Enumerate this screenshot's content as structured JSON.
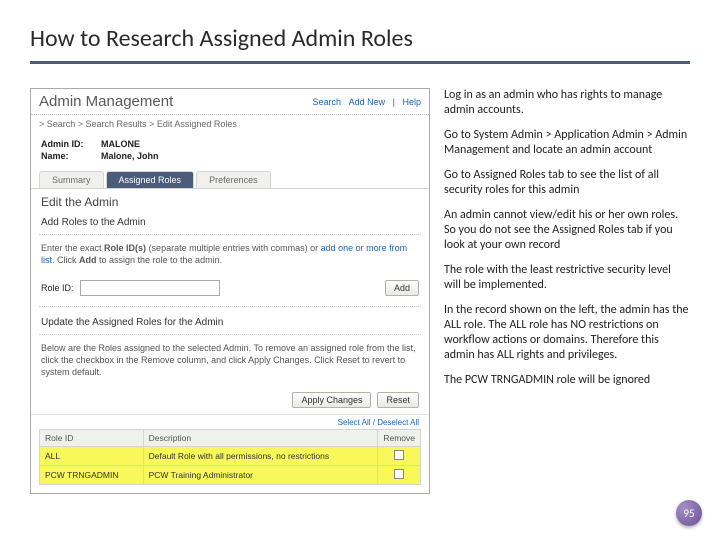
{
  "title": "How to Research Assigned Admin Roles",
  "app": {
    "header_title": "Admin Management",
    "links": {
      "search": "Search",
      "add_new": "Add New",
      "help": "Help"
    },
    "crumb": "> Search > Search Results > Edit Assigned Roles",
    "admin_id_label": "Admin ID:",
    "admin_id_value": "MALONE",
    "name_label": "Name:",
    "name_value": "Malone, John",
    "tabs": {
      "summary": "Summary",
      "assigned": "Assigned Roles",
      "prefs": "Preferences"
    },
    "edit_heading": "Edit the Admin",
    "add_roles_heading": "Add Roles to the Admin",
    "add_roles_text1": "Enter the exact ",
    "add_roles_bold": "Role ID(s)",
    "add_roles_text2": " (separate multiple entries with commas) or ",
    "add_roles_link": "add one or more from list",
    "add_roles_text3": ". Click ",
    "add_roles_bold2": "Add",
    "add_roles_text4": " to assign the role to the admin.",
    "role_id_label": "Role ID:",
    "add_btn": "Add",
    "update_heading": "Update the Assigned Roles for the Admin",
    "update_text": "Below are the Roles assigned to the selected Admin. To remove an assigned role from the list, click the checkbox in the Remove column, and click Apply Changes. Click Reset to revert to system default.",
    "apply_btn": "Apply Changes",
    "reset_btn": "Reset",
    "select_all": "Select All / Deselect All",
    "table": {
      "cols": {
        "role_id": "Role ID",
        "desc": "Description",
        "remove": "Remove"
      },
      "rows": [
        {
          "role_id": "ALL",
          "desc": "Default Role with all permissions, no restrictions",
          "hl": true
        },
        {
          "role_id": "PCW TRNGADMIN",
          "desc": "PCW Training Administrator",
          "hl": true
        }
      ]
    }
  },
  "bullets": {
    "b1": "Log in as an admin who has rights to manage admin accounts.",
    "b2": "Go to System Admin > Application Admin > Admin Management and locate an admin account",
    "b3": "Go to Assigned Roles tab to see the list of all security roles for this admin",
    "b4": "An admin cannot view/edit his or her own roles. So you do not see the Assigned Roles tab if you look at your own record",
    "b5": "The role with the least restrictive security level will be implemented.",
    "b6": "In the record  shown on the left, the admin has the ALL role. The ALL role has NO restrictions on workflow actions or domains. Therefore this admin has ALL rights and privileges.",
    "b7": "The PCW TRNGADMIN role will be ignored"
  },
  "page_number": "95"
}
